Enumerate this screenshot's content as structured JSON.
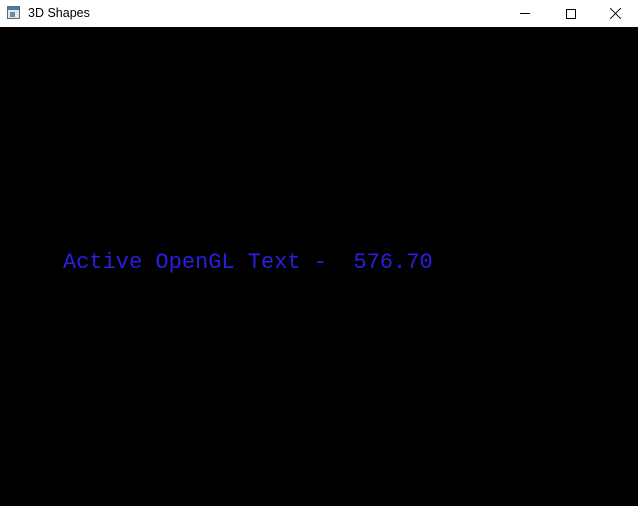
{
  "window": {
    "title": "3D Shapes",
    "app_icon": "window-app-icon",
    "controls": {
      "minimize_icon": "minimize-icon",
      "maximize_icon": "maximize-icon",
      "close_icon": "close-icon"
    }
  },
  "canvas": {
    "background_color": "#000000",
    "text": "Active OpenGL Text -  576.70",
    "text_color": "#2a1ee0"
  }
}
